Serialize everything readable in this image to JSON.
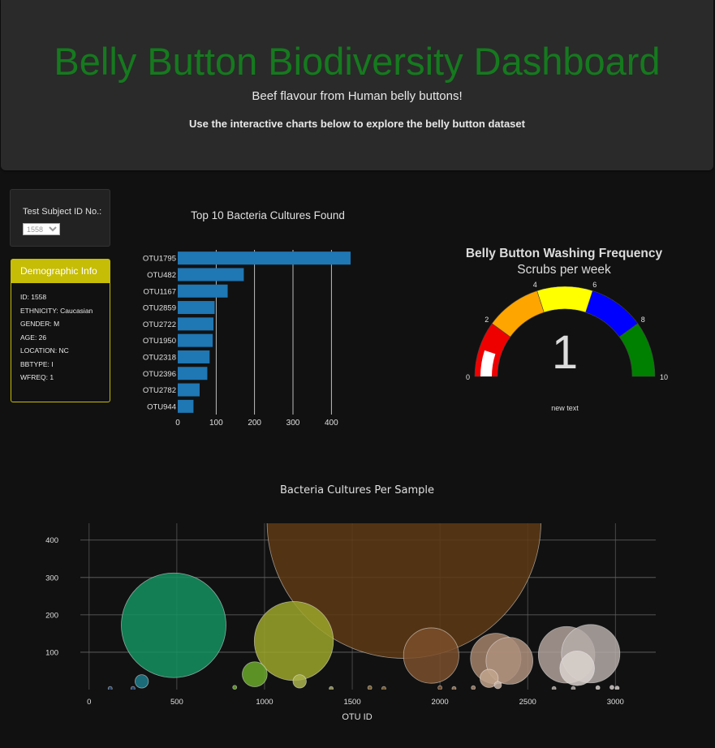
{
  "header": {
    "title": "Belly Button Biodiversity Dashboard",
    "subtitle": "Beef flavour from Human belly buttons!",
    "instructions": "Use the interactive charts below to explore the belly button dataset"
  },
  "selector": {
    "label": "Test Subject ID No.:",
    "selected": "1558"
  },
  "demographic": {
    "title": "Demographic Info",
    "rows": [
      "ID: 1558",
      "ETHNICITY: Caucasian",
      "GENDER: M",
      "AGE: 26",
      "LOCATION: NC",
      "BBTYPE: I",
      "WFREQ: 1"
    ]
  },
  "colors": {
    "bar": "#1f77b4",
    "title_green": "#157a1e",
    "demo_border": "#c6bd06",
    "gauge_bands": [
      "#ee0000",
      "#ffa500",
      "#ffff00",
      "#0000ff",
      "#008000"
    ],
    "gauge_bar": "#ffffff"
  },
  "chart_data": [
    {
      "type": "bar",
      "orientation": "horizontal",
      "title": "Top 10 Bacteria Cultures Found",
      "categories": [
        "OTU1795",
        "OTU482",
        "OTU1167",
        "OTU2859",
        "OTU2722",
        "OTU1950",
        "OTU2318",
        "OTU2396",
        "OTU2782",
        "OTU944"
      ],
      "values": [
        450,
        172,
        130,
        96,
        93,
        91,
        83,
        77,
        57,
        41
      ],
      "xticks": [
        0,
        100,
        200,
        300,
        400
      ],
      "xlim": [
        0,
        450
      ],
      "grid": true
    },
    {
      "type": "gauge",
      "title": "Belly Button Washing Frequency",
      "subtitle": "Scrubs per week",
      "value": 1,
      "range": [
        0,
        10
      ],
      "ticks": [
        0,
        2,
        4,
        6,
        8,
        10
      ],
      "bands": [
        [
          0,
          2
        ],
        [
          2,
          4
        ],
        [
          4,
          6
        ],
        [
          6,
          8
        ],
        [
          8,
          10
        ]
      ],
      "footer": "new text"
    },
    {
      "type": "scatter",
      "subtype": "bubble",
      "title": "Bacteria Cultures Per Sample",
      "xlabel": "OTU ID",
      "xticks": [
        0,
        500,
        1000,
        1500,
        2000,
        2500,
        3000
      ],
      "yticks": [
        100,
        200,
        300,
        400
      ],
      "xlim": [
        -50,
        3230
      ],
      "ylim": [
        0,
        445
      ],
      "grid": true,
      "points": [
        {
          "x": 1795,
          "y": 450,
          "size": 450,
          "color": "#5e3a14"
        },
        {
          "x": 482,
          "y": 172,
          "size": 172,
          "color": "#149160"
        },
        {
          "x": 1167,
          "y": 130,
          "size": 130,
          "color": "#9ba52a"
        },
        {
          "x": 1950,
          "y": 91,
          "size": 91,
          "color": "#7b4f2c"
        },
        {
          "x": 2318,
          "y": 83,
          "size": 83,
          "color": "#a3826a"
        },
        {
          "x": 2396,
          "y": 77,
          "size": 77,
          "color": "#ae917c"
        },
        {
          "x": 2722,
          "y": 93,
          "size": 93,
          "color": "#b0a19a"
        },
        {
          "x": 2859,
          "y": 96,
          "size": 96,
          "color": "#b5aca8"
        },
        {
          "x": 2782,
          "y": 57,
          "size": 57,
          "color": "#d9d1cc"
        },
        {
          "x": 944,
          "y": 41,
          "size": 41,
          "color": "#6aa82a"
        },
        {
          "x": 300,
          "y": 22,
          "size": 22,
          "color": "#1e7b8c"
        },
        {
          "x": 1200,
          "y": 22,
          "size": 22,
          "color": "#aab34e"
        },
        {
          "x": 2280,
          "y": 30,
          "size": 30,
          "color": "#c2a48c"
        },
        {
          "x": 2330,
          "y": 12,
          "size": 12,
          "color": "#c9b4a4"
        },
        {
          "x": 830,
          "y": 6,
          "size": 6,
          "color": "#6aa82a"
        },
        {
          "x": 1600,
          "y": 5,
          "size": 5,
          "color": "#8a6a3a"
        },
        {
          "x": 2000,
          "y": 5,
          "size": 5,
          "color": "#7b4f2c"
        },
        {
          "x": 2190,
          "y": 5,
          "size": 5,
          "color": "#a3826a"
        },
        {
          "x": 2900,
          "y": 5,
          "size": 5,
          "color": "#d0c8c4"
        },
        {
          "x": 2980,
          "y": 6,
          "size": 6,
          "color": "#d0c8c4"
        },
        {
          "x": 3010,
          "y": 4,
          "size": 4,
          "color": "#d0c8c4"
        },
        {
          "x": 120,
          "y": 3,
          "size": 3,
          "color": "#2a4f80"
        },
        {
          "x": 250,
          "y": 3,
          "size": 3,
          "color": "#2a4f80"
        },
        {
          "x": 1380,
          "y": 3,
          "size": 3,
          "color": "#a0a060"
        },
        {
          "x": 1680,
          "y": 3,
          "size": 3,
          "color": "#8a6a3a"
        },
        {
          "x": 2080,
          "y": 3,
          "size": 3,
          "color": "#9a7a5a"
        },
        {
          "x": 2650,
          "y": 3,
          "size": 3,
          "color": "#b0a8a2"
        },
        {
          "x": 2760,
          "y": 3,
          "size": 3,
          "color": "#b0a8a2"
        }
      ]
    }
  ]
}
